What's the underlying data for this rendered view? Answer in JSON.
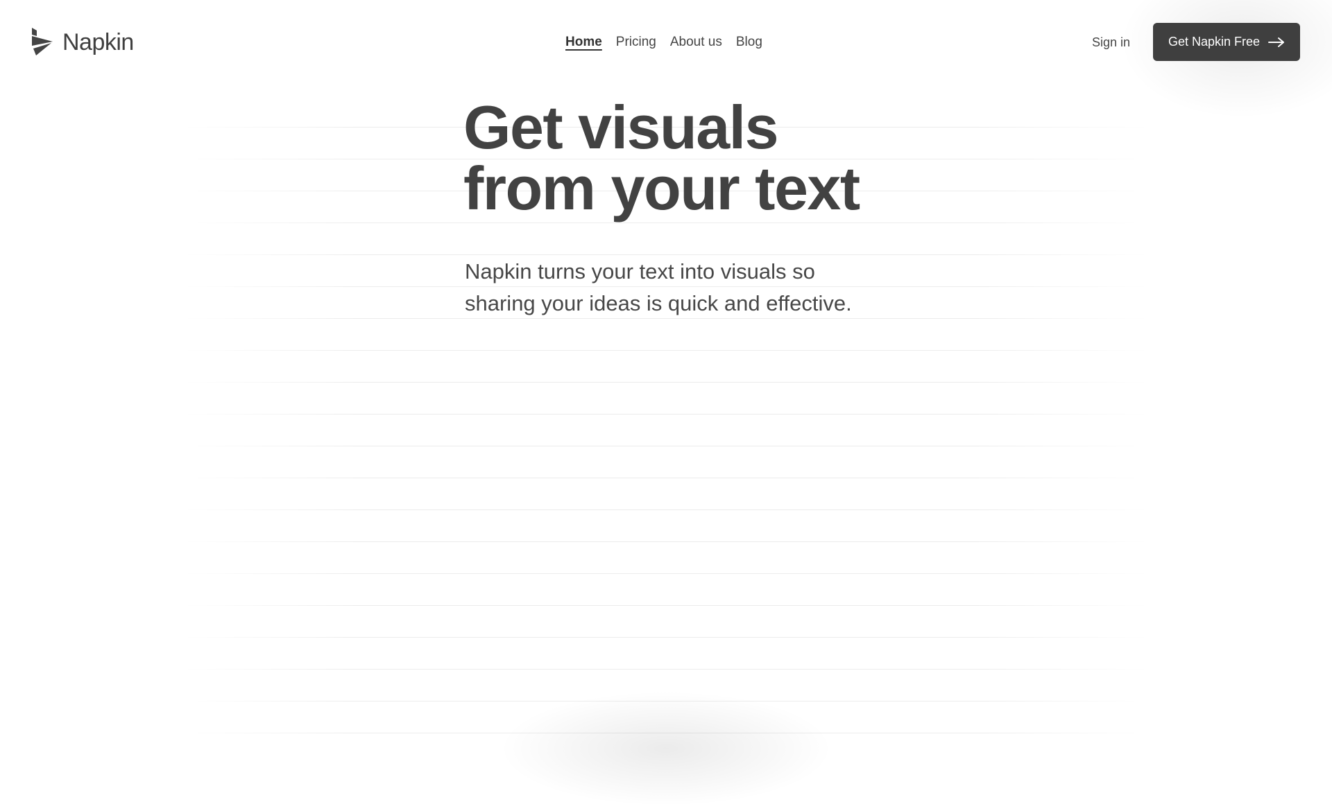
{
  "brand": {
    "name": "Napkin",
    "logo_icon": "napkin-logo-icon"
  },
  "nav": {
    "items": [
      {
        "label": "Home",
        "active": true
      },
      {
        "label": "Pricing",
        "active": false
      },
      {
        "label": "About us",
        "active": false
      },
      {
        "label": "Blog",
        "active": false
      }
    ]
  },
  "header": {
    "signin_label": "Sign in",
    "cta_label": "Get Napkin Free",
    "cta_icon": "arrow-right-icon"
  },
  "hero": {
    "title_line1": "Get visuals",
    "title_line2": "from your text",
    "subtitle": "Napkin turns your text into visuals so sharing your ideas is quick and effective."
  },
  "colors": {
    "text": "#3f3f3f",
    "button_bg": "#3f3f3f",
    "button_text": "#ffffff",
    "background": "#ffffff",
    "ruled_lines": "#ececec"
  }
}
